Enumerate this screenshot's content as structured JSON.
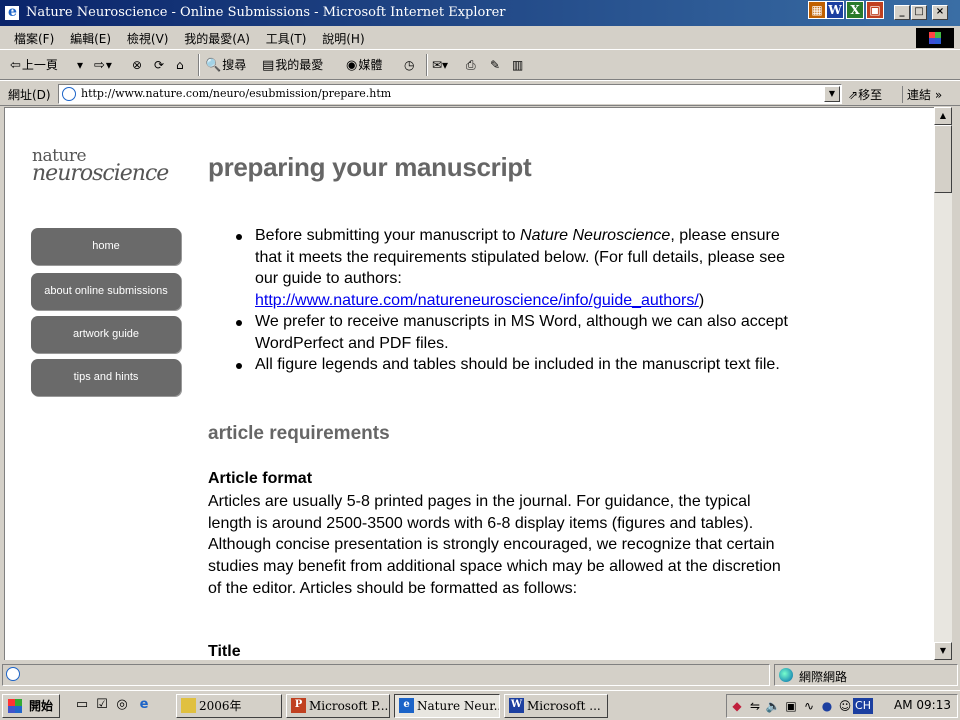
{
  "window": {
    "title": "Nature Neuroscience - Online Submissions - Microsoft Internet Explorer",
    "min": "_",
    "max": "□",
    "close": "×"
  },
  "menu": {
    "items": [
      "檔案(F)",
      "編輯(E)",
      "檢視(V)",
      "我的最愛(A)",
      "工具(T)",
      "說明(H)"
    ]
  },
  "toolbar": {
    "back": "上一頁",
    "search": "搜尋",
    "favorites": "我的最愛",
    "media": "媒體"
  },
  "address": {
    "label": "網址(D)",
    "url": "http://www.nature.com/neuro/esubmission/prepare.htm",
    "go": "移至",
    "links": "連結"
  },
  "page": {
    "logo_line1": "nature",
    "logo_line2": "neuroscience",
    "nav": [
      "home",
      "about online submissions",
      "artwork guide",
      "tips and hints"
    ],
    "title": "preparing your manuscript",
    "bullet1_a": "Before submitting your manuscript to ",
    "bullet1_em": "Nature Neuroscience",
    "bullet1_b": ", please ensure that it meets the requirements stipulated below. (For full details, please see our guide to authors:",
    "bullet1_link": "http://www.nature.com/natureneuroscience/info/guide_authors/",
    "bullet1_c": ")",
    "bullet2": "We prefer to receive manuscripts in MS Word, although we can also accept WordPerfect and PDF files.",
    "bullet3": "All figure legends and tables should be included in the manuscript text file.",
    "section_heading": "article requirements",
    "subheading": "Article format",
    "paragraph": "Articles are usually 5-8 printed pages in the journal. For guidance, the typical length is around 2500-3500 words with 6-8 display items (figures and tables). Although concise presentation is strongly encouraged, we recognize that certain studies may benefit from additional space which may be allowed at the discretion of the editor. Articles should be formatted as follows:",
    "subheading2": "Title"
  },
  "status": {
    "zone": "網際網路"
  },
  "taskbar": {
    "start": "開始",
    "tasks": [
      "2006年",
      "Microsoft P...",
      "Nature Neur...",
      "Microsoft ..."
    ],
    "clock": "AM 09:13",
    "ime": "CH"
  }
}
